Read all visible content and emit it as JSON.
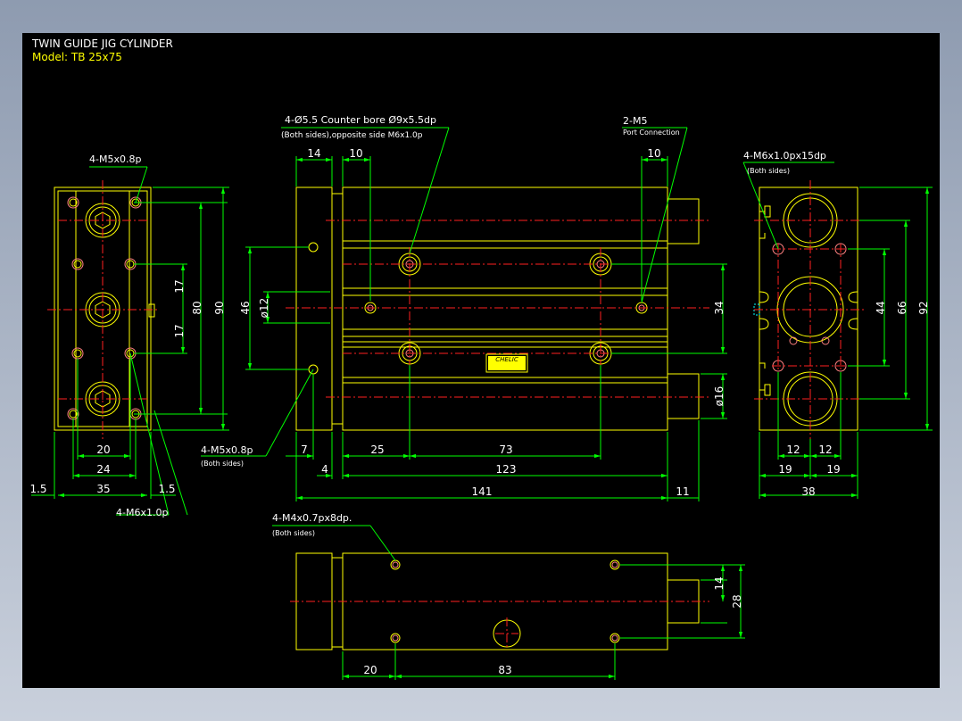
{
  "title": {
    "line1": "TWIN GUIDE JIG CYLINDER",
    "line2": "Model: TB 25x75"
  },
  "colors": {
    "background": "#000000",
    "outline": "#ffff00",
    "dimension": "#00ff00",
    "centerline": "#ff2020",
    "text": "#ffffff",
    "frame": "#8e9bb0"
  },
  "callouts": {
    "counterbore_line1": "4-Ø5.5 Counter bore Ø9x5.5dp",
    "counterbore_line2": "(Both sides),opposite side M6x1.0p",
    "port_line1": "2-M5",
    "port_line2": "Port Connection",
    "left_top": "4-M5x0.8p",
    "left_bottom": "4-M6x1.0p",
    "front_bottom_line1": "4-M5x0.8p",
    "front_bottom_line2": "(Both sides)",
    "right_top_line1": "4-M6x1.0px15dp",
    "right_top_line2": "(Both sides)",
    "bottom_line1": "4-M4x0.7px8dp.",
    "bottom_line2": "(Both sides)",
    "brand": "CHELIC"
  },
  "dims": {
    "d14": "14",
    "d10a": "10",
    "d10b": "10",
    "d46": "46",
    "d12dia": "ø12",
    "d34": "34",
    "d16dia": "ø16",
    "d7": "7",
    "d25": "25",
    "d73": "73",
    "d4": "4",
    "d123": "123",
    "d141": "141",
    "d11": "11",
    "l17a": "17",
    "l17b": "17",
    "l80": "80",
    "l90": "90",
    "l20": "20",
    "l24": "24",
    "l35": "35",
    "l15a": "1.5",
    "l15b": "1.5",
    "r44": "44",
    "r66": "66",
    "r92": "92",
    "r12a": "12",
    "r12b": "12",
    "r19a": "19",
    "r19b": "19",
    "r38": "38",
    "b14": "14",
    "b28": "28",
    "b20": "20",
    "b83": "83"
  }
}
